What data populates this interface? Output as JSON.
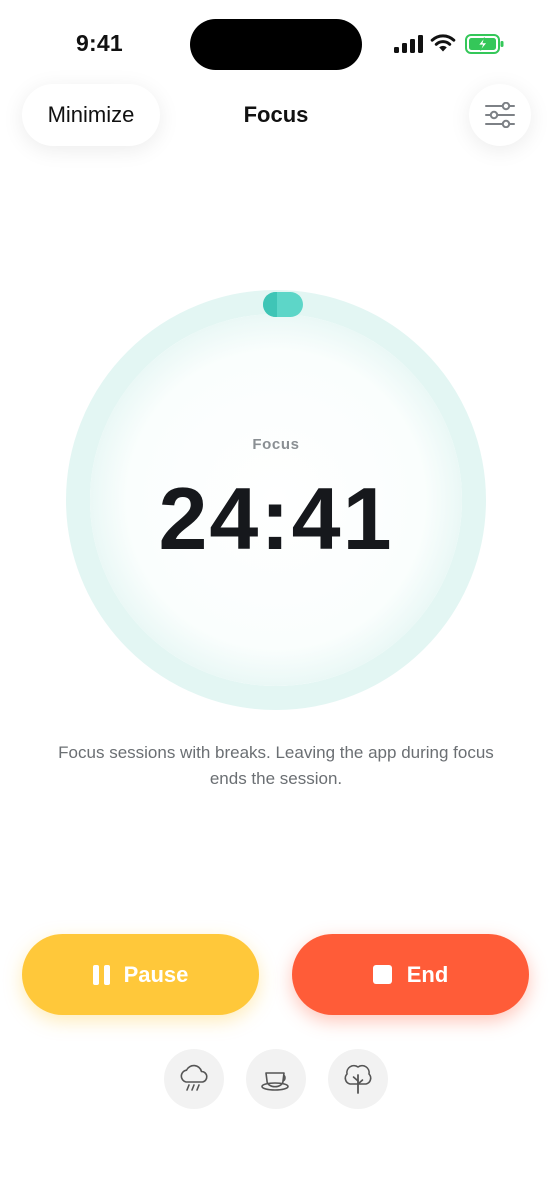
{
  "status_bar": {
    "time": "9:41",
    "icons": [
      "signal-icon",
      "wifi-icon",
      "battery-charging-icon"
    ]
  },
  "header": {
    "minimize_label": "Minimize",
    "title": "Focus",
    "settings_icon": "sliders-icon"
  },
  "timer": {
    "label": "Focus",
    "value": "24:41",
    "ring_color": "#e3f6f3",
    "accent_color": "#45cfc0"
  },
  "description": "Focus sessions with breaks. Leaving the app during focus ends the session.",
  "actions": {
    "pause_label": "Pause",
    "pause_color": "#ffc83a",
    "end_label": "End",
    "end_color": "#ff5c38"
  },
  "ambient_sounds": [
    {
      "icon": "rain-cloud-icon"
    },
    {
      "icon": "coffee-cup-icon"
    },
    {
      "icon": "tree-icon"
    }
  ]
}
